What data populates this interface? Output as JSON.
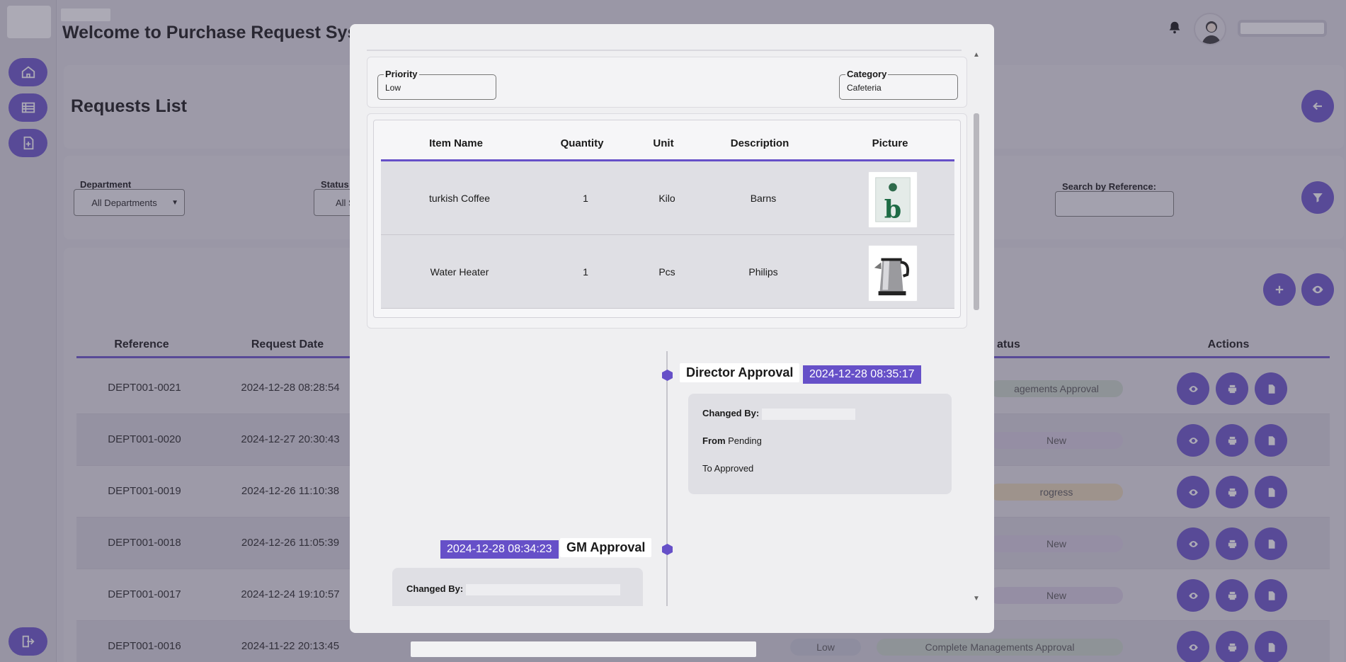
{
  "app": {
    "title": "Welcome to Purchase Request Syst",
    "page_title": "Requests List"
  },
  "filters": {
    "department_label": "Department",
    "department_value": "All Departments",
    "status_label": "Status:",
    "status_value": "All S",
    "search_label": "Search by Reference:"
  },
  "table": {
    "headers": [
      "Reference",
      "Request Date",
      "atus",
      "Actions"
    ],
    "rows": [
      {
        "ref": "DEPT001-0021",
        "date": "2024-12-28 08:28:54",
        "priority": "",
        "status": "agements Approval",
        "status_color": "#c8d6c9"
      },
      {
        "ref": "DEPT001-0020",
        "date": "2024-12-27 20:30:43",
        "priority": "",
        "status": "New",
        "status_color": "#d6cce0"
      },
      {
        "ref": "DEPT001-0019",
        "date": "2024-12-26 11:10:38",
        "priority": "",
        "status": "rogress",
        "status_color": "#e6d5b5"
      },
      {
        "ref": "DEPT001-0018",
        "date": "2024-12-26 11:05:39",
        "priority": "",
        "status": "New",
        "status_color": "#d6cce0"
      },
      {
        "ref": "DEPT001-0017",
        "date": "2024-12-24 19:10:57",
        "priority": "",
        "status": "New",
        "status_color": "#d6cce0"
      },
      {
        "ref": "DEPT001-0016",
        "date": "2024-11-22 20:13:45",
        "priority": "Low",
        "status": "Complete Managements Approval",
        "status_color": "#c8d6c9"
      }
    ]
  },
  "modal": {
    "priority_label": "Priority",
    "priority_value": "Low",
    "category_label": "Category",
    "category_value": "Cafeteria",
    "item_headers": [
      "Item Name",
      "Quantity",
      "Unit",
      "Description",
      "Picture"
    ],
    "items": [
      {
        "name": "turkish Coffee",
        "qty": "1",
        "unit": "Kilo",
        "desc": "Barns",
        "picture": "coffee-bag-image"
      },
      {
        "name": "Water Heater",
        "qty": "1",
        "unit": "Pcs",
        "desc": "Philips",
        "picture": "kettle-image"
      }
    ],
    "timeline": [
      {
        "title": "Director Approval",
        "date": "2024-12-28 08:35:17",
        "changed_by_label": "Changed By:",
        "from_label": "From",
        "from_value": "Pending",
        "to_label": "To",
        "to_value": "Approved"
      },
      {
        "title": "GM Approval",
        "date": "2024-12-28 08:34:23",
        "changed_by_label": "Changed By:"
      }
    ]
  },
  "colors": {
    "accent": "#6650c8",
    "modal_bg": "#efeff1"
  }
}
